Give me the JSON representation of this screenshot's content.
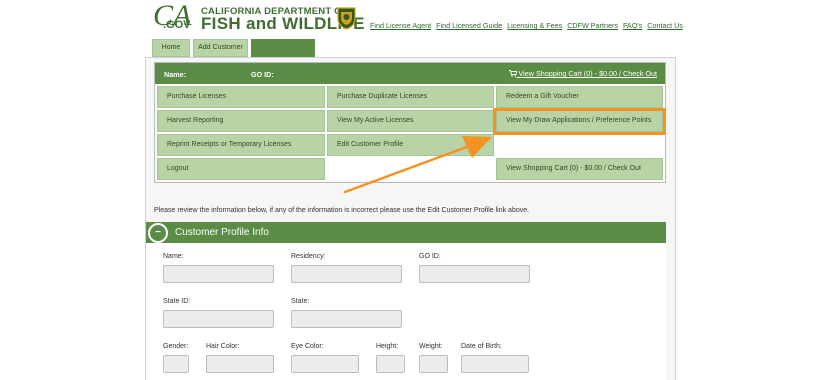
{
  "header": {
    "logo_ca": "CA",
    "logo_gov": ".GOV",
    "logo_line1": "CALIFORNIA DEPARTMENT OF",
    "logo_line2": "FISH and WILDLIFE",
    "links": [
      "Find License Agent",
      "Find Licensed Guide",
      "Licensing & Fees",
      "CDFW Partners",
      "FAQ's",
      "Contact Us"
    ]
  },
  "tabs": [
    "Home",
    "Add Customer",
    ""
  ],
  "menu": {
    "name_label": "Name:",
    "goid_label": "GO ID:",
    "cart_link": "View Shopping Cart (0) - $0.00 / Check Out",
    "buttons": {
      "purchase_licenses": "Purchase Licenses",
      "purchase_duplicate": "Purchase Duplicate Licenses",
      "redeem_voucher": "Redeem a Gift Voucher",
      "harvest_reporting": "Harvest Reporting",
      "active_licenses": "View My Active Licenses",
      "draw_applications": "View My Draw Applications / Preference Points",
      "reprint": "Reprint Receipts or Temporary Licenses",
      "edit_profile": "Edit Customer Profile",
      "logout": "Logout",
      "cart_button": "View Shopping Cart (0) - $0.00 / Check Out"
    }
  },
  "notice": "Please review the information below, if any of the information is incorrect please use the Edit Customer Profile link above.",
  "profile": {
    "toggle": "−",
    "title": "Customer Profile Info",
    "fields": {
      "name": {
        "label": "Name:",
        "value": ""
      },
      "residency": {
        "label": "Residency:",
        "value": ""
      },
      "go_id": {
        "label": "GO ID:",
        "value": ""
      },
      "state_id": {
        "label": "State ID:",
        "value": ""
      },
      "state": {
        "label": "State:",
        "value": ""
      },
      "gender": {
        "label": "Gender:",
        "value": ""
      },
      "hair_color": {
        "label": "Hair Color:",
        "value": ""
      },
      "eye_color": {
        "label": "Eye Color:",
        "value": ""
      },
      "height": {
        "label": "Height:",
        "value": ""
      },
      "weight": {
        "label": "Weight:",
        "value": ""
      },
      "dob": {
        "label": "Date of Birth:",
        "value": ""
      }
    }
  },
  "colors": {
    "brand_green": "#5b8c45",
    "button_green": "#b8d3a6",
    "highlight_orange": "#f39322",
    "link_green": "#2d6a2d"
  },
  "icons": {
    "cart": "cart-icon",
    "badge": "cdfw-badge-icon",
    "collapse": "minus-icon"
  }
}
